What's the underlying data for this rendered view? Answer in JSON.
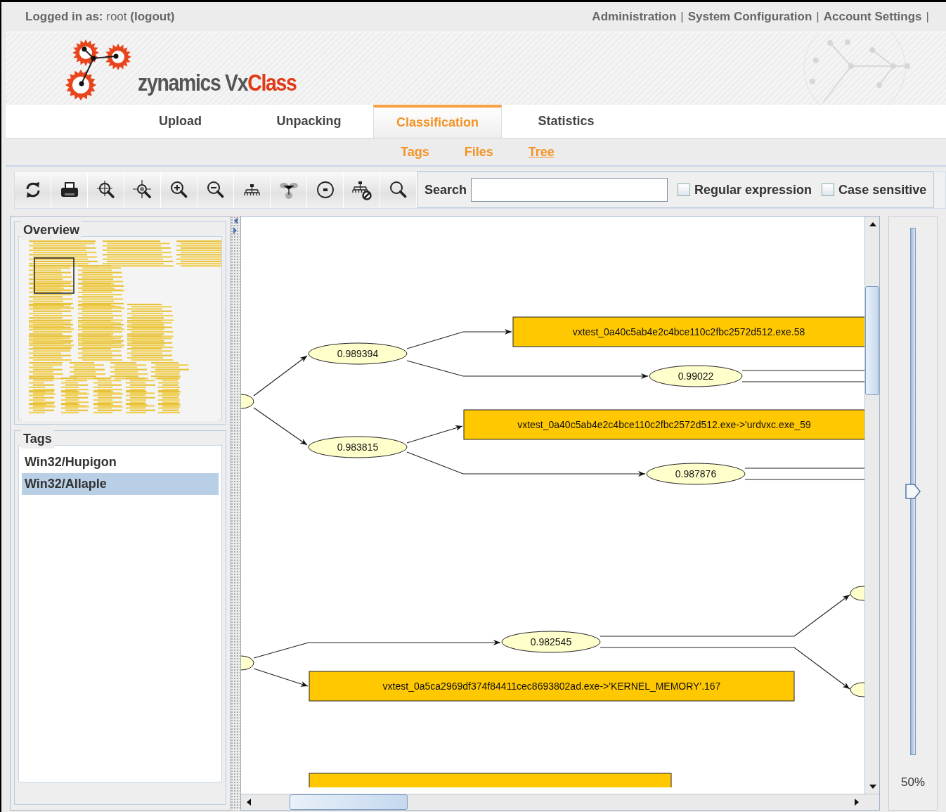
{
  "top_bar": {
    "login_label": "Logged in as:",
    "user": "root",
    "logout": "(logout)",
    "links": [
      {
        "label": "Administration",
        "separator": "|"
      },
      {
        "label": "System Configuration",
        "separator": "|"
      },
      {
        "label": "Account Settings",
        "separator": "|"
      }
    ]
  },
  "logo": {
    "prefix": "zynamics Vx",
    "accent": "Class"
  },
  "tabs": [
    {
      "label": "Upload",
      "selected": false
    },
    {
      "label": "Unpacking",
      "selected": false
    },
    {
      "label": "Classification",
      "selected": true
    },
    {
      "label": "Statistics",
      "selected": false
    }
  ],
  "subtabs": [
    {
      "label": "Tags",
      "selected": false
    },
    {
      "label": "Files",
      "selected": false
    },
    {
      "label": "Tree",
      "selected": true
    }
  ],
  "toolbar": {
    "search_label": "Search",
    "options": [
      {
        "label": "Regular expression",
        "checked": false
      },
      {
        "label": "Case sensitive",
        "checked": false
      }
    ]
  },
  "overview": {
    "title": "Overview"
  },
  "tags": {
    "title": "Tags",
    "items": [
      {
        "label": "Win32/Hupigon",
        "selected": false
      },
      {
        "label": "Win32/Allaple",
        "selected": true
      }
    ]
  },
  "graph": {
    "nodes": [
      {
        "kind": "ellipse"
      },
      {
        "kind": "ellipse",
        "label": "0.989394"
      },
      {
        "kind": "ellipse",
        "label": "0.983815"
      },
      {
        "kind": "box",
        "label": "vxtest_0a40c5ab4e2c4bce110c2fbc2572d512.exe.58"
      },
      {
        "kind": "ellipse",
        "label": "0.99022"
      },
      {
        "kind": "box",
        "label": "vxtest_0a40c5ab4e2c4bce110c2fbc2572d512.exe->'urdvxc.exe_59"
      },
      {
        "kind": "ellipse",
        "label": "0.987876"
      },
      {
        "kind": "ellipse"
      },
      {
        "kind": "ellipse",
        "label": "0.982545"
      },
      {
        "kind": "box",
        "label": "vxtest_0a5ca2969df374f84411cec8693802ad.exe->'KERNEL_MEMORY'.167"
      },
      {
        "kind": "ellipse"
      },
      {
        "kind": "ellipse"
      },
      {
        "kind": "box"
      }
    ]
  },
  "zoom": {
    "level": 0.5,
    "reading": "50%"
  }
}
